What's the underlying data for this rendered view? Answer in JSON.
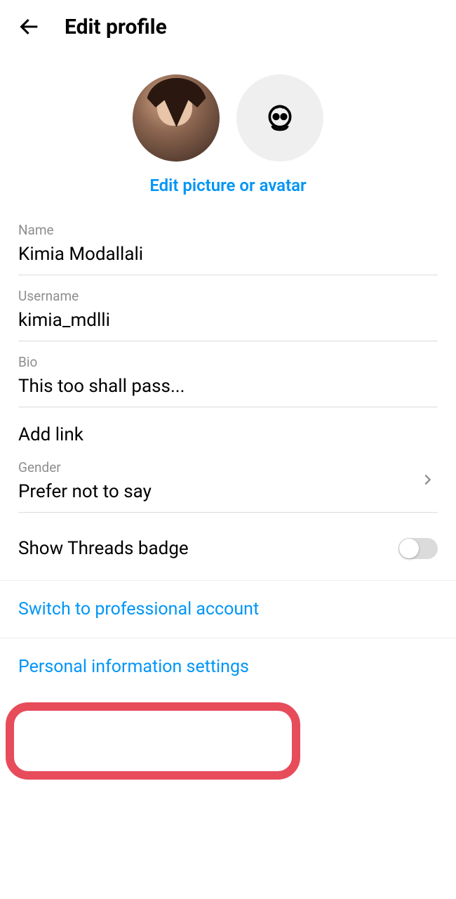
{
  "header": {
    "title": "Edit profile"
  },
  "avatar": {
    "edit_link": "Edit picture or avatar"
  },
  "fields": {
    "name": {
      "label": "Name",
      "value": "Kimia Modallali"
    },
    "username": {
      "label": "Username",
      "value": "kimia_mdlli"
    },
    "bio": {
      "label": "Bio",
      "value": "This too shall pass..."
    },
    "add_link": "Add link",
    "gender": {
      "label": "Gender",
      "value": "Prefer not to say"
    },
    "threads": {
      "label": "Show Threads badge"
    }
  },
  "links": {
    "professional": "Switch to professional account",
    "personal_info": "Personal information settings"
  }
}
